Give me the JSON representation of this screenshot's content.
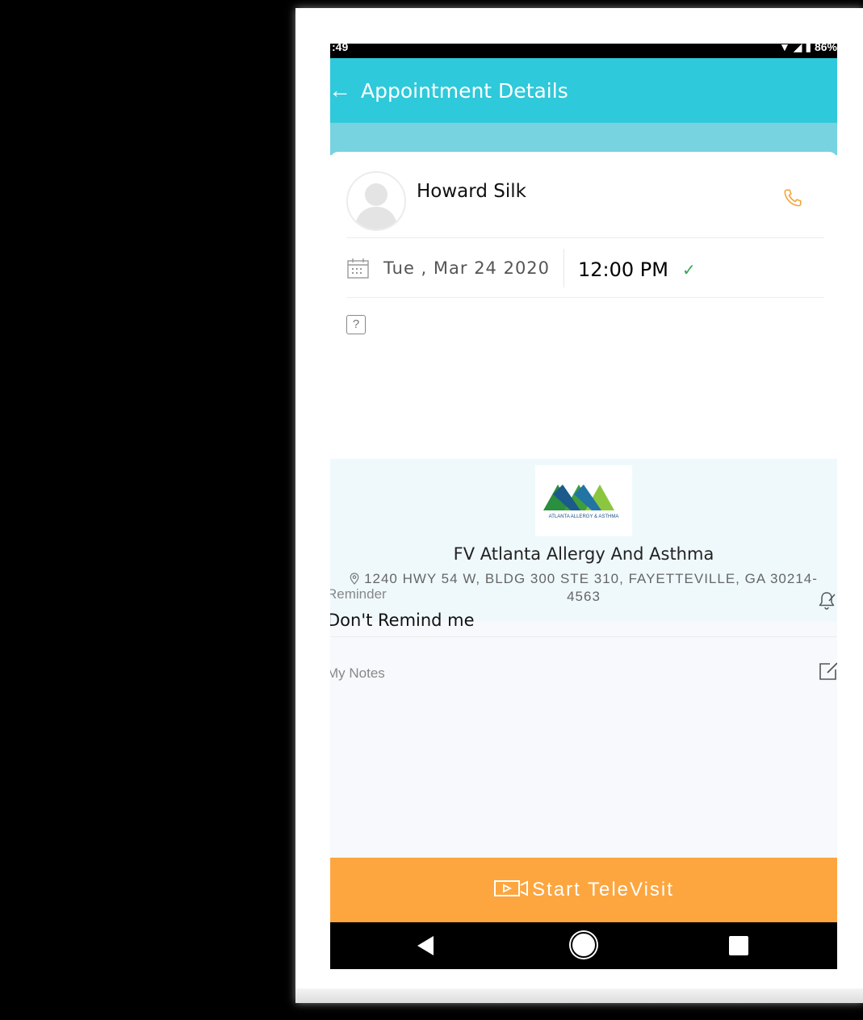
{
  "status_bar": {
    "left": ":49",
    "right": "▼ ◢ ▮ 86%"
  },
  "app_bar": {
    "back_icon": "arrow-left-icon",
    "title": "Appointment Details"
  },
  "appointment": {
    "provider_name": "Howard Silk",
    "date": "Tue , Mar 24 2020",
    "time": "12:00 PM",
    "status_icon": "check-icon",
    "unknown_icon": "?"
  },
  "clinic": {
    "logo_text": "ATLANTA ALLERGY & ASTHMA",
    "name": "FV Atlanta Allergy And Asthma",
    "address": "1240 HWY 54  W, BLDG 300 STE 310, FAYETTEVILLE, GA 30214-4563"
  },
  "reminder": {
    "label": "Reminder",
    "value": "Don't Remind me"
  },
  "notes": {
    "label": "My Notes"
  },
  "actions": {
    "start_televisit": "Start TeleVisit"
  },
  "colors": {
    "app_bar": "#2ec9da",
    "accent": "#fda63f",
    "check": "#2fa84f"
  }
}
